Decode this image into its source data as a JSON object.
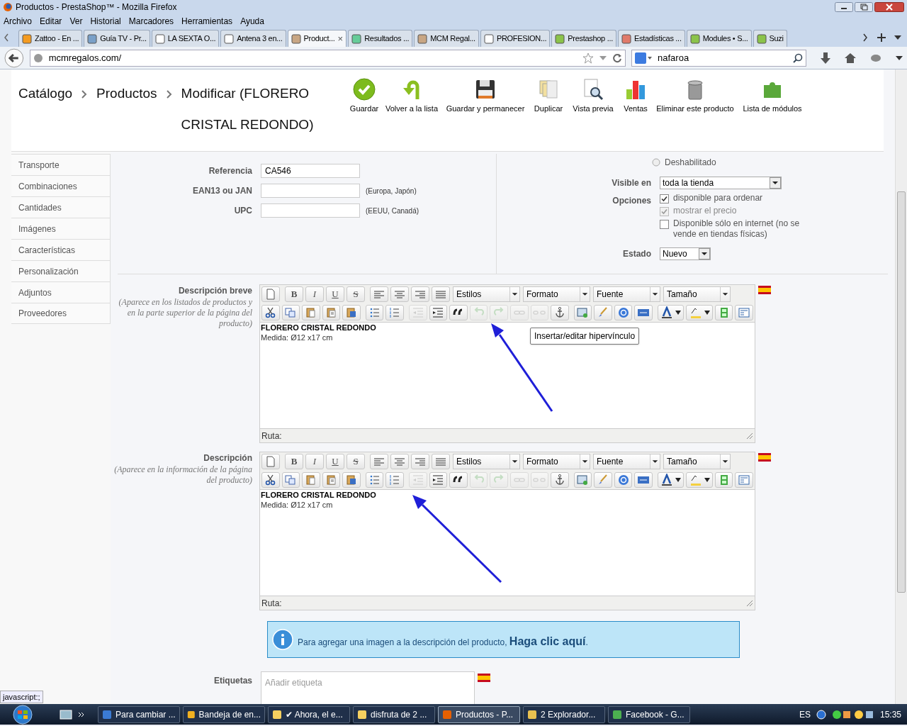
{
  "window": {
    "title": "Productos - PrestaShop™ - Mozilla Firefox"
  },
  "menu": [
    "Archivo",
    "Editar",
    "Ver",
    "Historial",
    "Marcadores",
    "Herramientas",
    "Ayuda"
  ],
  "tabs": [
    {
      "label": "Zattoo - En ...",
      "selected": false
    },
    {
      "label": "Guía TV - Pr...",
      "selected": false
    },
    {
      "label": "LA SEXTA O...",
      "selected": false
    },
    {
      "label": "Antena 3 en...",
      "selected": false
    },
    {
      "label": "Product...",
      "selected": true,
      "close": "×"
    },
    {
      "label": "Resultados ...",
      "selected": false
    },
    {
      "label": "MCM Regal...",
      "selected": false
    },
    {
      "label": "PROFESION...",
      "selected": false
    },
    {
      "label": "Prestashop ...",
      "selected": false
    },
    {
      "label": "Estadísticas ...",
      "selected": false
    },
    {
      "label": "Modules • S...",
      "selected": false
    },
    {
      "label": "Suzi",
      "selected": false
    }
  ],
  "address": "mcmregalos.com/",
  "search": "nafaroa",
  "header": {
    "breadcrumb": [
      "Catálogo",
      "Productos",
      "Modificar (FLORERO CRISTAL REDONDO)"
    ],
    "actions": [
      "Guardar",
      "Volver a la lista",
      "Guardar y permanecer",
      "Duplicar",
      "Vista previa",
      "Ventas",
      "Eliminar este producto",
      "Lista de módulos"
    ]
  },
  "sidebar": [
    {
      "label": "Transporte",
      "selected": false
    },
    {
      "label": "Combinaciones",
      "selected": false
    },
    {
      "label": "Cantidades",
      "selected": false
    },
    {
      "label": "Imágenes",
      "selected": false
    },
    {
      "label": "Características",
      "selected": false
    },
    {
      "label": "Personalización",
      "selected": false
    },
    {
      "label": "Adjuntos",
      "selected": false
    },
    {
      "label": "Proveedores",
      "selected": false
    }
  ],
  "fields": [
    {
      "label": "Referencia",
      "value": "CA546"
    },
    {
      "label": "EAN13 ou JAN",
      "hint": "(Europa, Japón)"
    },
    {
      "label": "UPC",
      "hint": "(EEUU, Canadá)"
    }
  ],
  "estado_radio": {
    "label": "Deshabilitado",
    "selected": false
  },
  "visible_en": {
    "label": "Visible en",
    "value": "toda la tienda"
  },
  "opciones": {
    "label": "Opciones",
    "items": [
      {
        "label": "disponible para ordenar",
        "checked": true,
        "disabled": false
      },
      {
        "label": "mostrar el precio",
        "checked": true,
        "disabled": true
      },
      {
        "label": "Disponible sólo en internet (no se vende en tiendas físicas)",
        "checked": false,
        "disabled": false
      }
    ]
  },
  "condicion": {
    "label": "Estado",
    "value": "Nuevo"
  },
  "editors": [
    {
      "label": "Descripción breve",
      "help": "(Aparece en los listados de productos y en la parte superior de la página del producto)",
      "dropdowns": [
        "Estilos",
        "Formato",
        "Fuente",
        "Tamaño"
      ],
      "chars": [
        "B",
        "I",
        "U",
        "S"
      ],
      "content_title": "FLORERO CRISTAL REDONDO",
      "content_line": "Medida: Ø12 x17 cm",
      "path": "Ruta:"
    },
    {
      "label": "Descripción",
      "help": "(Aparece en la información de la página del producto)",
      "dropdowns": [
        "Estilos",
        "Formato",
        "Fuente",
        "Tamaño"
      ],
      "chars": [
        "B",
        "I",
        "U",
        "S"
      ],
      "content_title": "FLORERO CRISTAL REDONDO",
      "content_line": "Medida: Ø12 x17 cm",
      "path": "Ruta:"
    }
  ],
  "toolbar_row2": [
    {
      "disabled": false
    },
    {
      "disabled": false
    },
    {
      "disabled": false
    },
    {
      "disabled": false
    },
    {
      "disabled": false
    },
    {
      "disabled": false
    },
    {
      "disabled": false
    },
    {
      "disabled": true
    },
    {
      "disabled": false
    },
    {
      "disabled": false
    },
    {
      "disabled": true
    },
    {
      "disabled": true
    },
    {
      "disabled": true
    },
    {
      "disabled": true
    },
    {
      "disabled": false
    },
    {
      "disabled": false
    },
    {
      "disabled": false
    },
    {
      "disabled": false
    },
    {
      "disabled": false
    },
    {
      "disabled": false
    },
    {
      "disabled": false
    },
    {
      "disabled": false
    },
    {
      "disabled": false
    }
  ],
  "tooltip": "Insertar/editar hipervínculo",
  "info": {
    "text": "Para agregar una imagen a la descripción del producto,",
    "link": "Haga clic aquí",
    "end": "."
  },
  "tags": {
    "label": "Etiquetas",
    "placeholder": "Añadir etiqueta"
  },
  "status_url": "javascript:;",
  "taskbar": [
    {
      "label": "Para cambiar ...",
      "selected": false
    },
    {
      "label": "Bandeja de en...",
      "selected": false
    },
    {
      "label": "✔ Ahora, el e...",
      "selected": false
    },
    {
      "label": "disfruta de 2 ...",
      "selected": false
    },
    {
      "label": "Productos - P...",
      "selected": true
    },
    {
      "label": "2 Explorador...",
      "selected": false
    },
    {
      "label": "Facebook - G...",
      "selected": false
    }
  ],
  "tray": {
    "lang": "ES",
    "clock": "15:35"
  }
}
